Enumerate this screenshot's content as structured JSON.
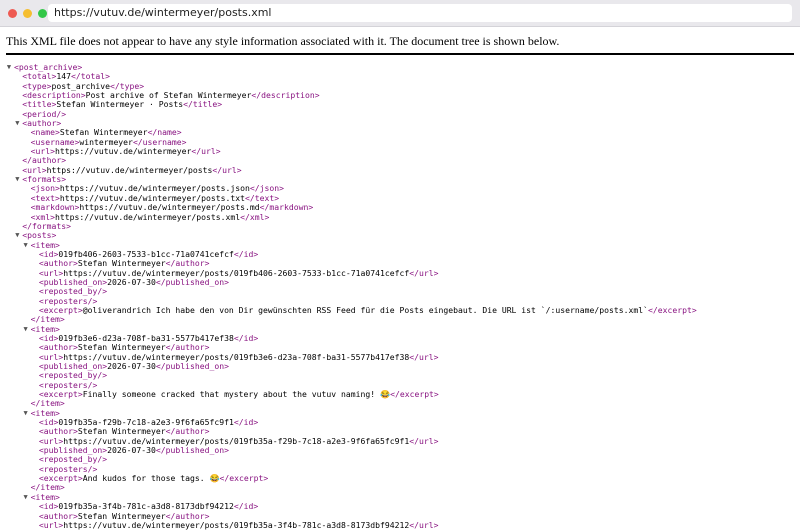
{
  "window": {
    "url": "https://vutuv.de/wintermeyer/posts.xml",
    "colors": {
      "close": "#ee5a52",
      "minimize": "#f5be30",
      "zoom": "#33c748"
    }
  },
  "notice": "This XML file does not appear to have any style information associated with it. The document tree is shown below.",
  "tree": [
    {
      "d": 0,
      "t": "<post_archive>",
      "tog": true
    },
    {
      "d": 1,
      "o": "<total>",
      "v": "147",
      "c": "</total>"
    },
    {
      "d": 1,
      "o": "<type>",
      "v": "post_archive",
      "c": "</type>"
    },
    {
      "d": 1,
      "o": "<description>",
      "v": "Post archive of Stefan Wintermeyer",
      "c": "</description>"
    },
    {
      "d": 1,
      "o": "<title>",
      "v": "Stefan Wintermeyer · Posts",
      "c": "</title>"
    },
    {
      "d": 1,
      "t": "<period/>"
    },
    {
      "d": 1,
      "t": "<author>",
      "tog": true
    },
    {
      "d": 2,
      "o": "<name>",
      "v": "Stefan Wintermeyer",
      "c": "</name>"
    },
    {
      "d": 2,
      "o": "<username>",
      "v": "wintermeyer",
      "c": "</username>"
    },
    {
      "d": 2,
      "o": "<url>",
      "v": "https://vutuv.de/wintermeyer",
      "c": "</url>"
    },
    {
      "d": 1,
      "t": "</author>"
    },
    {
      "d": 1,
      "o": "<url>",
      "v": "https://vutuv.de/wintermeyer/posts",
      "c": "</url>"
    },
    {
      "d": 1,
      "t": "<formats>",
      "tog": true
    },
    {
      "d": 2,
      "o": "<json>",
      "v": "https://vutuv.de/wintermeyer/posts.json",
      "c": "</json>"
    },
    {
      "d": 2,
      "o": "<text>",
      "v": "https://vutuv.de/wintermeyer/posts.txt",
      "c": "</text>"
    },
    {
      "d": 2,
      "o": "<markdown>",
      "v": "https://vutuv.de/wintermeyer/posts.md",
      "c": "</markdown>"
    },
    {
      "d": 2,
      "o": "<xml>",
      "v": "https://vutuv.de/wintermeyer/posts.xml",
      "c": "</xml>"
    },
    {
      "d": 1,
      "t": "</formats>"
    },
    {
      "d": 1,
      "t": "<posts>",
      "tog": true
    },
    {
      "d": 2,
      "t": "<item>",
      "tog": true
    },
    {
      "d": 3,
      "o": "<id>",
      "v": "019fb406-2603-7533-b1cc-71a0741cefcf",
      "c": "</id>"
    },
    {
      "d": 3,
      "o": "<author>",
      "v": "Stefan Wintermeyer",
      "c": "</author>"
    },
    {
      "d": 3,
      "o": "<url>",
      "v": "https://vutuv.de/wintermeyer/posts/019fb406-2603-7533-b1cc-71a0741cefcf",
      "c": "</url>"
    },
    {
      "d": 3,
      "o": "<published_on>",
      "v": "2026-07-30",
      "c": "</published_on>"
    },
    {
      "d": 3,
      "t": "<reposted_by/>"
    },
    {
      "d": 3,
      "t": "<reposters/>"
    },
    {
      "d": 3,
      "o": "<excerpt>",
      "v": "@oliverandrich Ich habe den von Dir gewünschten RSS Feed für die Posts eingebaut. Die URL ist `/:username/posts.xml`",
      "c": "</excerpt>"
    },
    {
      "d": 2,
      "t": "</item>"
    },
    {
      "d": 2,
      "t": "<item>",
      "tog": true
    },
    {
      "d": 3,
      "o": "<id>",
      "v": "019fb3e6-d23a-708f-ba31-5577b417ef38",
      "c": "</id>"
    },
    {
      "d": 3,
      "o": "<author>",
      "v": "Stefan Wintermeyer",
      "c": "</author>"
    },
    {
      "d": 3,
      "o": "<url>",
      "v": "https://vutuv.de/wintermeyer/posts/019fb3e6-d23a-708f-ba31-5577b417ef38",
      "c": "</url>"
    },
    {
      "d": 3,
      "o": "<published_on>",
      "v": "2026-07-30",
      "c": "</published_on>"
    },
    {
      "d": 3,
      "t": "<reposted_by/>"
    },
    {
      "d": 3,
      "t": "<reposters/>"
    },
    {
      "d": 3,
      "o": "<excerpt>",
      "v": "Finally someone cracked that mystery about the vutuv naming! 😂",
      "c": "</excerpt>"
    },
    {
      "d": 2,
      "t": "</item>"
    },
    {
      "d": 2,
      "t": "<item>",
      "tog": true
    },
    {
      "d": 3,
      "o": "<id>",
      "v": "019fb35a-f29b-7c18-a2e3-9f6fa65fc9f1",
      "c": "</id>"
    },
    {
      "d": 3,
      "o": "<author>",
      "v": "Stefan Wintermeyer",
      "c": "</author>"
    },
    {
      "d": 3,
      "o": "<url>",
      "v": "https://vutuv.de/wintermeyer/posts/019fb35a-f29b-7c18-a2e3-9f6fa65fc9f1",
      "c": "</url>"
    },
    {
      "d": 3,
      "o": "<published_on>",
      "v": "2026-07-30",
      "c": "</published_on>"
    },
    {
      "d": 3,
      "t": "<reposted_by/>"
    },
    {
      "d": 3,
      "t": "<reposters/>"
    },
    {
      "d": 3,
      "o": "<excerpt>",
      "v": "And kudos for those tags. 😂",
      "c": "</excerpt>"
    },
    {
      "d": 2,
      "t": "</item>"
    },
    {
      "d": 2,
      "t": "<item>",
      "tog": true
    },
    {
      "d": 3,
      "o": "<id>",
      "v": "019fb35a-3f4b-781c-a3d8-8173dbf94212",
      "c": "</id>"
    },
    {
      "d": 3,
      "o": "<author>",
      "v": "Stefan Wintermeyer",
      "c": "</author>"
    },
    {
      "d": 3,
      "o": "<url>",
      "v": "https://vutuv.de/wintermeyer/posts/019fb35a-3f4b-781c-a3d8-8173dbf94212",
      "c": "</url>"
    }
  ]
}
